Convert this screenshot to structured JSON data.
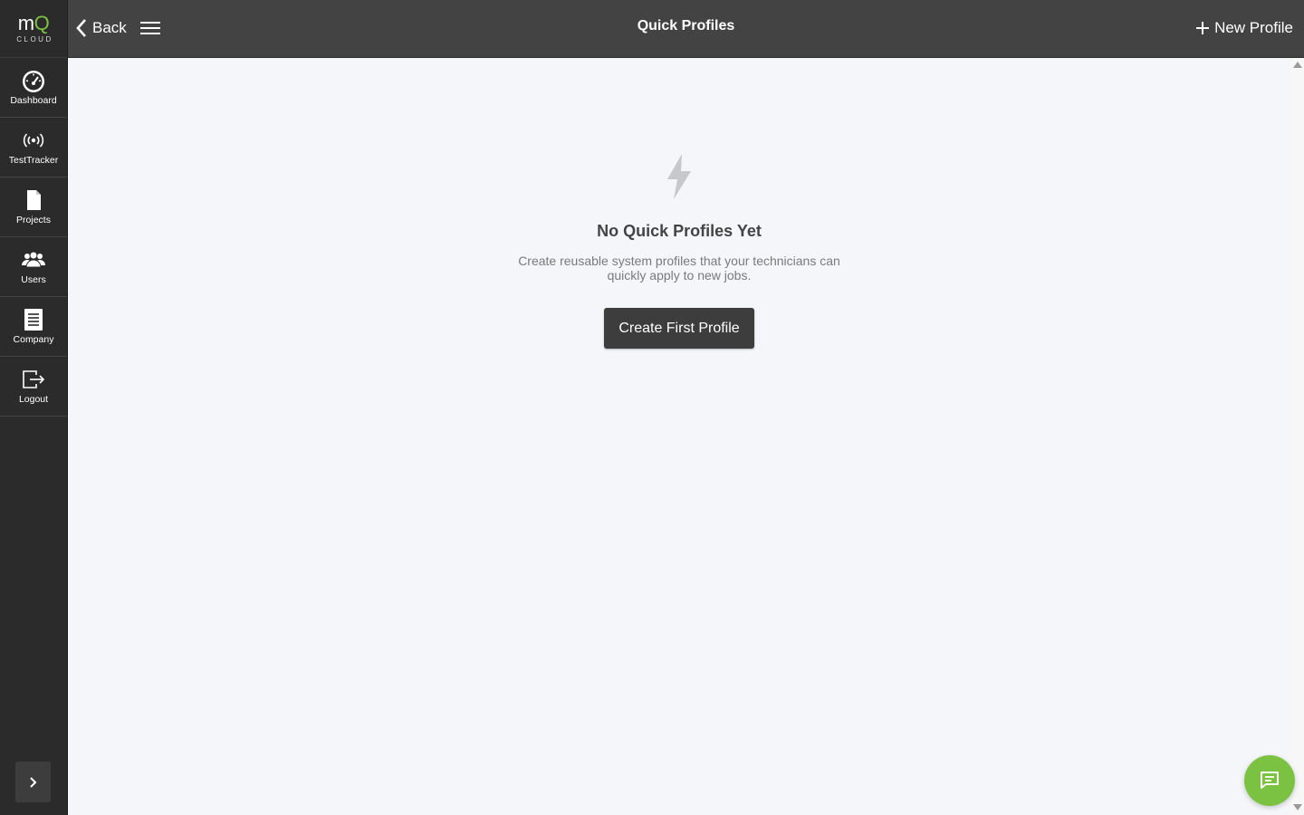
{
  "brand": {
    "logo_main_prefix": "m",
    "logo_main_accent": "Q",
    "logo_sub": "CLOUD",
    "accent_color": "#7cc242"
  },
  "sidebar": {
    "items": [
      {
        "label": "Dashboard",
        "icon": "speedometer-icon"
      },
      {
        "label": "TestTracker",
        "icon": "broadcast-icon"
      },
      {
        "label": "Projects",
        "icon": "document-icon"
      },
      {
        "label": "Users",
        "icon": "users-icon"
      },
      {
        "label": "Company",
        "icon": "clipboard-icon"
      },
      {
        "label": "Logout",
        "icon": "logout-icon"
      }
    ],
    "expand_icon": "chevron-right-icon"
  },
  "header": {
    "back_label": "Back",
    "title": "Quick Profiles",
    "new_profile_label": "New Profile"
  },
  "empty_state": {
    "icon": "lightning-bolt-icon",
    "title": "No Quick Profiles Yet",
    "description": "Create reusable system profiles that your technicians can quickly apply to new jobs.",
    "button_label": "Create First Profile"
  },
  "chat": {
    "icon": "chat-icon"
  },
  "colors": {
    "sidebar_bg": "#2b2b2b",
    "topbar_bg": "#434343",
    "content_bg": "#f4f6f9",
    "button_bg": "#3d3d3d"
  }
}
